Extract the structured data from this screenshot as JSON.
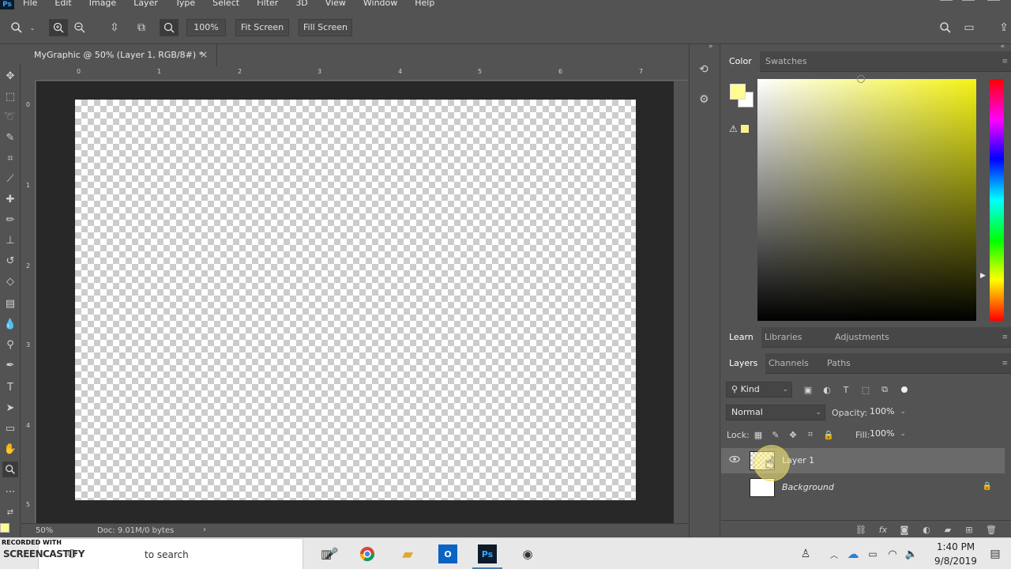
{
  "menu": [
    "File",
    "Edit",
    "Image",
    "Layer",
    "Type",
    "Select",
    "Filter",
    "3D",
    "View",
    "Window",
    "Help"
  ],
  "options": {
    "zoom_level": "100%",
    "fit_screen": "Fit Screen",
    "fill_screen": "Fill Screen"
  },
  "document": {
    "tab_title": "MyGraphic @ 50% (Layer 1, RGB/8#) *",
    "close": "×",
    "ruler_h": [
      "0",
      "1",
      "2",
      "3",
      "4",
      "5",
      "6",
      "7"
    ],
    "ruler_v": [
      "0",
      "1",
      "2",
      "3",
      "4",
      "5"
    ],
    "status_zoom": "50%",
    "status_doc": "Doc: 9.01M/0 bytes",
    "status_arrow": "›"
  },
  "panels": {
    "color_tabs": [
      "Color",
      "Swatches"
    ],
    "learn_tabs": [
      "Learn",
      "Libraries",
      "Adjustments"
    ],
    "layers_tabs": [
      "Layers",
      "Channels",
      "Paths"
    ],
    "filter_kind": "Kind",
    "blend_mode": "Normal",
    "opacity_label": "Opacity:",
    "opacity_value": "100%",
    "lock_label": "Lock:",
    "fill_label": "Fill:",
    "fill_value": "100%",
    "layers": [
      {
        "name": "Layer 1",
        "selected": true
      },
      {
        "name": "Background",
        "selected": false
      }
    ],
    "foreground_color": "#fdfb92",
    "background_color": "#ffffff"
  },
  "taskbar": {
    "search_placeholder": "Type here to search",
    "search_visible": "to search",
    "time": "1:40 PM",
    "date": "9/8/2019",
    "ps_label": "Ps"
  },
  "watermark": {
    "line1": "RECORDED WITH",
    "line2": "SCREENCASTIFY"
  }
}
